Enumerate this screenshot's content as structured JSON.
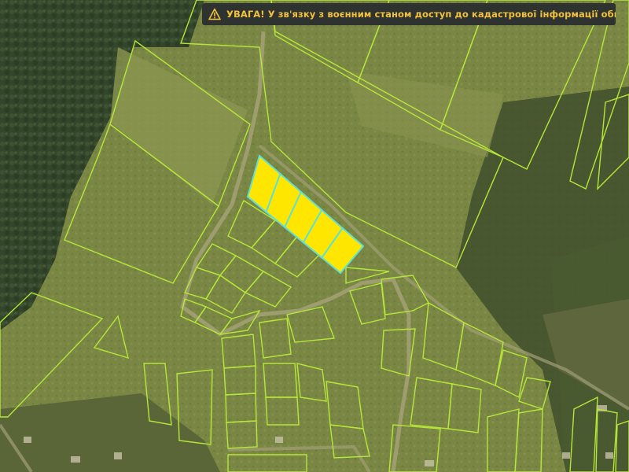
{
  "banner": {
    "icon": "warning-icon",
    "text": "УВАГА! У зв'язку з воєнним станом доступ до кадастрової інформації обмежений.",
    "text_color": "#f2c23c",
    "background": "#2f3330"
  },
  "map": {
    "parcel_outline_color": "#b7e63a",
    "selected_parcel_fill": "#ffe600",
    "selected_parcel_outline": "#5ee0d6",
    "selected_parcel_count": 5
  }
}
